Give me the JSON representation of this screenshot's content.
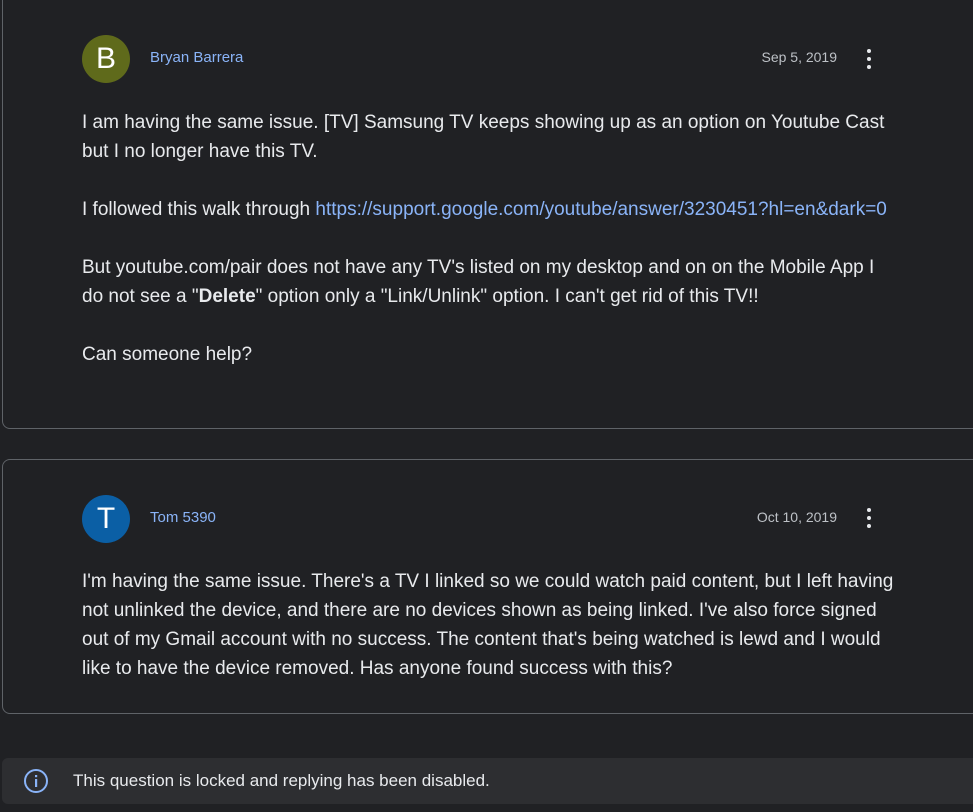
{
  "colors": {
    "background": "#202124",
    "card_border": "#5f6368",
    "link": "#8ab4f8",
    "text": "#e8eaed",
    "muted_text": "#bdc1c6",
    "locked_bar": "#2d2e31",
    "info_icon": "#8ab4f8"
  },
  "posts": [
    {
      "avatar_letter": "B",
      "avatar_color": "#5f6a1b",
      "author": "Bryan Barrera",
      "date": "Sep 5, 2019",
      "more_icon": "more-vert-icon",
      "p1": "I am having the same issue. [TV] Samsung TV keeps showing up as an option on Youtube Cast but I no longer have this TV.",
      "p2_prefix": "I followed this walk through ",
      "p2_link": "https://support.google.com/youtube/answer/3230451?hl=en&dark=0",
      "p3_before": "But youtube.com/pair does not have any TV's listed on my desktop and on on the Mobile App I do not see a \"",
      "p3_bold": "Delete",
      "p3_after": "\" option only a \"Link/Unlink\" option. I can't get rid of this TV!!",
      "p4": "Can someone help?"
    },
    {
      "avatar_letter": "T",
      "avatar_color": "#0b5fa5",
      "author": "Tom 5390",
      "date": "Oct 10, 2019",
      "more_icon": "more-vert-icon",
      "p1": "I'm having the same issue.  There's a TV I linked so we could watch paid content, but I left having not unlinked the device, and there are no devices shown as being linked.  I've also force signed out of my Gmail account with no success.  The content that's being watched is lewd and I would like to have the device removed.  Has anyone found success with this?"
    }
  ],
  "locked_notice": {
    "icon": "info-icon",
    "text": "This question is locked and replying has been disabled."
  }
}
